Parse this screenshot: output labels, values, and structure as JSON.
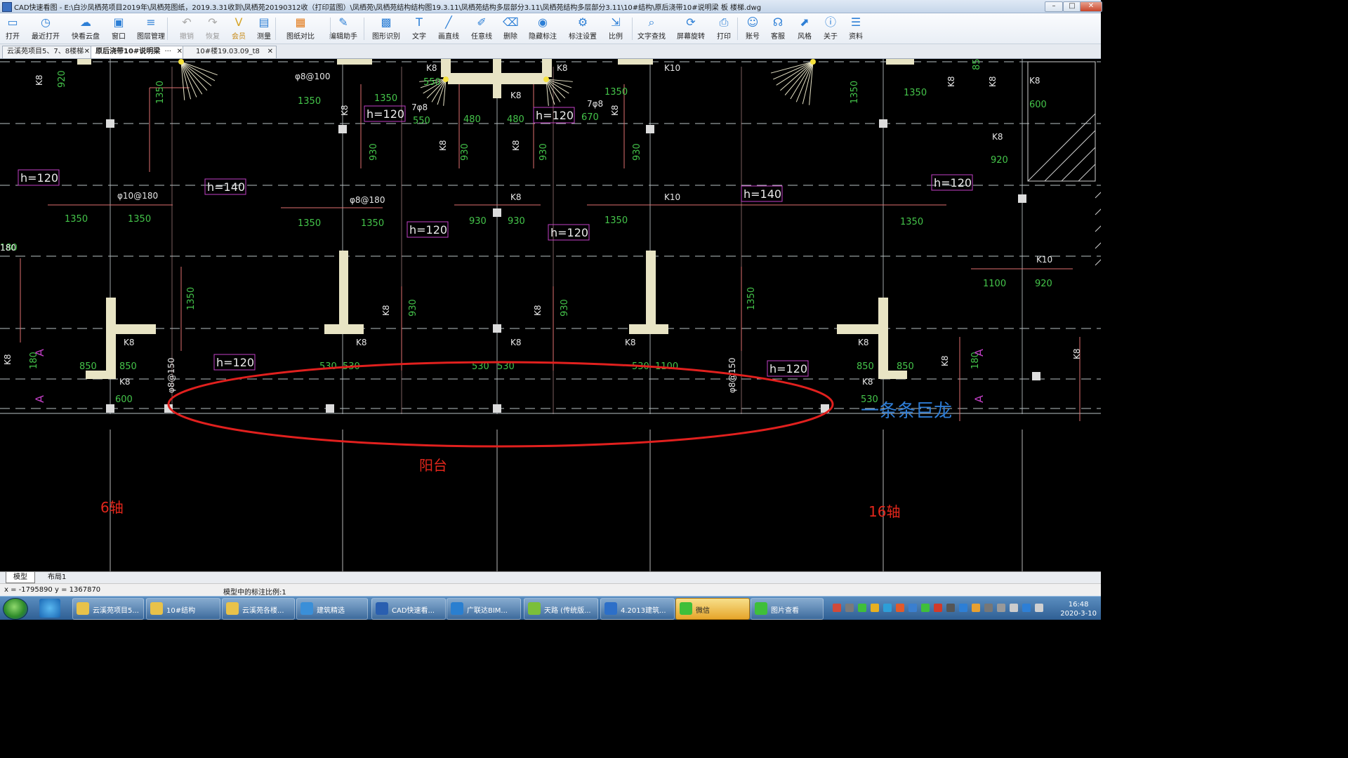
{
  "window": {
    "title": "CAD快速看图 - E:\\白沙凤栖苑项目2019年\\凤栖苑图纸，2019.3.31收到\\凤栖苑20190312收（打印蓝图）\\凤栖苑\\凤栖苑结构结构图19.3.11\\凤栖苑结构多层部分3.11\\凤栖苑结构多层部分3.11\\10#结构\\原后浇带10#说明梁 板 楼梯.dwg",
    "min_label": "–",
    "max_label": "□",
    "close_label": "✕"
  },
  "toolbar": {
    "items": [
      {
        "label": "打开",
        "icon": "folder-open-icon"
      },
      {
        "label": "最近打开",
        "icon": "history-icon"
      },
      {
        "label": "快看云盘",
        "icon": "cloud-icon"
      },
      {
        "label": "窗口",
        "icon": "window-icon"
      },
      {
        "label": "图层管理",
        "icon": "layers-icon"
      },
      {
        "label": "撤销",
        "icon": "undo-icon"
      },
      {
        "label": "恢复",
        "icon": "redo-icon"
      },
      {
        "label": "会员",
        "icon": "vip-icon"
      },
      {
        "label": "测量",
        "icon": "ruler-icon"
      },
      {
        "label": "图纸对比",
        "icon": "compare-icon"
      },
      {
        "label": "编辑助手",
        "icon": "edit-helper-icon"
      },
      {
        "label": "图形识别",
        "icon": "shape-recognize-icon"
      },
      {
        "label": "文字",
        "icon": "text-icon"
      },
      {
        "label": "画直线",
        "icon": "line-icon"
      },
      {
        "label": "任意线",
        "icon": "freehand-icon"
      },
      {
        "label": "删除",
        "icon": "eraser-icon"
      },
      {
        "label": "隐藏标注",
        "icon": "hide-markup-icon"
      },
      {
        "label": "标注设置",
        "icon": "markup-settings-icon"
      },
      {
        "label": "比例",
        "icon": "scale-icon"
      },
      {
        "label": "文字查找",
        "icon": "text-search-icon"
      },
      {
        "label": "屏幕旋转",
        "icon": "rotate-screen-icon"
      },
      {
        "label": "打印",
        "icon": "printer-icon"
      },
      {
        "label": "账号",
        "icon": "account-icon"
      },
      {
        "label": "客服",
        "icon": "headset-icon"
      },
      {
        "label": "风格",
        "icon": "style-icon"
      },
      {
        "label": "关于",
        "icon": "info-icon"
      },
      {
        "label": "资料",
        "icon": "documents-icon"
      }
    ]
  },
  "tabs": [
    {
      "label": "云溪苑项目5、7、8楼梯",
      "close": "✕",
      "active": false
    },
    {
      "label": "原后浇带10#说明梁",
      "close": "✕",
      "active": true,
      "more": "···"
    },
    {
      "label": "10#楼19.03.09_t8",
      "close": "✕",
      "active": false
    }
  ],
  "drawing": {
    "thickness_tags": [
      "h=120",
      "h=120",
      "h=120",
      "h=140",
      "h=120",
      "h=120",
      "h=120",
      "h=140",
      "h=120",
      "h=120",
      "h=120"
    ],
    "rebar_labels": [
      "φ8@100",
      "φ10@180",
      "φ8@180",
      "φ8@150",
      "φ8@150",
      "7φ8",
      "7φ8"
    ],
    "beam_marks": [
      "K8",
      "K8",
      "K8",
      "K8",
      "K8",
      "K8",
      "K10",
      "K10",
      "K10",
      "K8",
      "K8",
      "K8",
      "K8",
      "K8",
      "K8",
      "K8",
      "K8",
      "K8",
      "K8",
      "K8",
      "K8"
    ],
    "dims_green": [
      "920",
      "1350",
      "1350",
      "1350",
      "1350",
      "1350",
      "1350",
      "1350",
      "1350",
      "1350",
      "1350",
      "1350",
      "1350",
      "1350",
      "930",
      "930",
      "930",
      "930",
      "930",
      "930",
      "930",
      "930",
      "480",
      "480",
      "550",
      "550",
      "670",
      "850",
      "850",
      "850",
      "850",
      "850",
      "600",
      "600",
      "530",
      "530",
      "530",
      "530",
      "530",
      "530",
      "1100",
      "1100",
      "920",
      "920",
      "180"
    ],
    "section_marks": [
      "A",
      "A",
      "A",
      "A"
    ],
    "annotations": {
      "balcony": "阳台",
      "axis_6": "6轴",
      "axis_16": "16轴",
      "watermark": "一条条巨龙"
    },
    "colors": {
      "background": "#000000",
      "wall": "#e8e4c4",
      "grid_line": "#b9b9b9",
      "dimension_green": "#44c44a",
      "beam_red": "#e07070",
      "magenta": "#c23fc6",
      "highlight_ellipse": "#e1201e",
      "annotation_red": "#e2261b",
      "watermark_blue": "#2e7cd4"
    }
  },
  "model_tabs": [
    {
      "label": "模型",
      "active": true
    },
    {
      "label": "布局1",
      "active": false
    }
  ],
  "status": {
    "coords": "x = -1795890  y = 1367870",
    "scale": "模型中的标注比例:1"
  },
  "taskbar": {
    "tasks": [
      {
        "label": "云溪苑项目5...",
        "icon": "folder-icon"
      },
      {
        "label": "10#结构",
        "icon": "folder-icon"
      },
      {
        "label": "云溪苑各楼...",
        "icon": "folder-icon"
      },
      {
        "label": "建筑精选",
        "icon": "browser-icon"
      },
      {
        "label": "CAD快速看...",
        "icon": "cad-icon",
        "active": true
      },
      {
        "label": "广联达BIM...",
        "icon": "bim-icon"
      },
      {
        "label": "天路 (传统版...",
        "icon": "app-icon"
      },
      {
        "label": "4.2013建筑...",
        "icon": "word-icon"
      },
      {
        "label": "微信",
        "icon": "wechat-icon",
        "highlight": true
      },
      {
        "label": "图片查看",
        "icon": "image-viewer-icon"
      }
    ],
    "clock_time": "16:48",
    "clock_date": "2020-3-10"
  }
}
